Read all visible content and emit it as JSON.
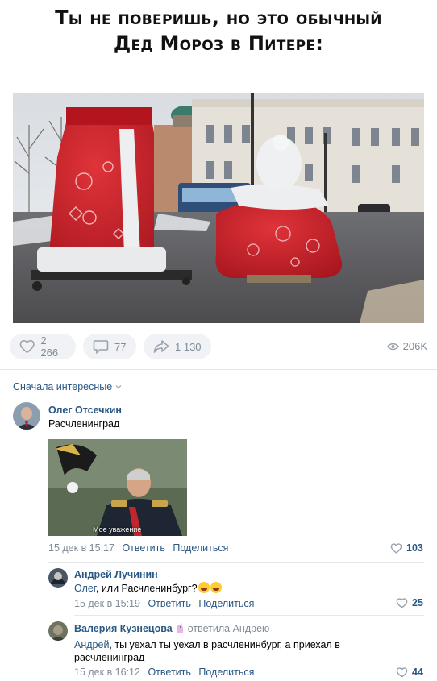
{
  "post": {
    "headline_line1": "Ты не поверишь, но это обычный",
    "headline_line2": "Дед Мороз в Питере:",
    "photo_icon": "santa-costume-statue-photo"
  },
  "actions": {
    "likes": "2 266",
    "comments": "77",
    "shares": "1 130",
    "views": "206K"
  },
  "comments_section": {
    "sort_label": "Сначала интересные"
  },
  "comments": [
    {
      "author": "Олег Отсечкин",
      "text": "Расчленинград",
      "attachment_caption": "Мое уважение",
      "date": "15 дек в 15:17",
      "reply_label": "Ответить",
      "share_label": "Поделиться",
      "likes": "103"
    },
    {
      "author": "Андрей Лучинин",
      "mention": "Олег",
      "text": ", или Расчленинбург?",
      "date": "15 дек в 15:19",
      "reply_label": "Ответить",
      "share_label": "Поделиться",
      "likes": "25"
    },
    {
      "author": "Валерия Кузнецова",
      "reply_to": "ответила Андрею",
      "mention": "Андрей",
      "text": ", ты уехал ты уехал в расчленинбург, а приехал в расчленинград",
      "date": "15 дек в 16:12",
      "reply_label": "Ответить",
      "share_label": "Поделиться",
      "likes": "44"
    }
  ],
  "colors": {
    "link": "#2a5885",
    "muted": "#818c99",
    "pill_bg": "#f0f2f5",
    "santa_red": "#c8202a"
  }
}
